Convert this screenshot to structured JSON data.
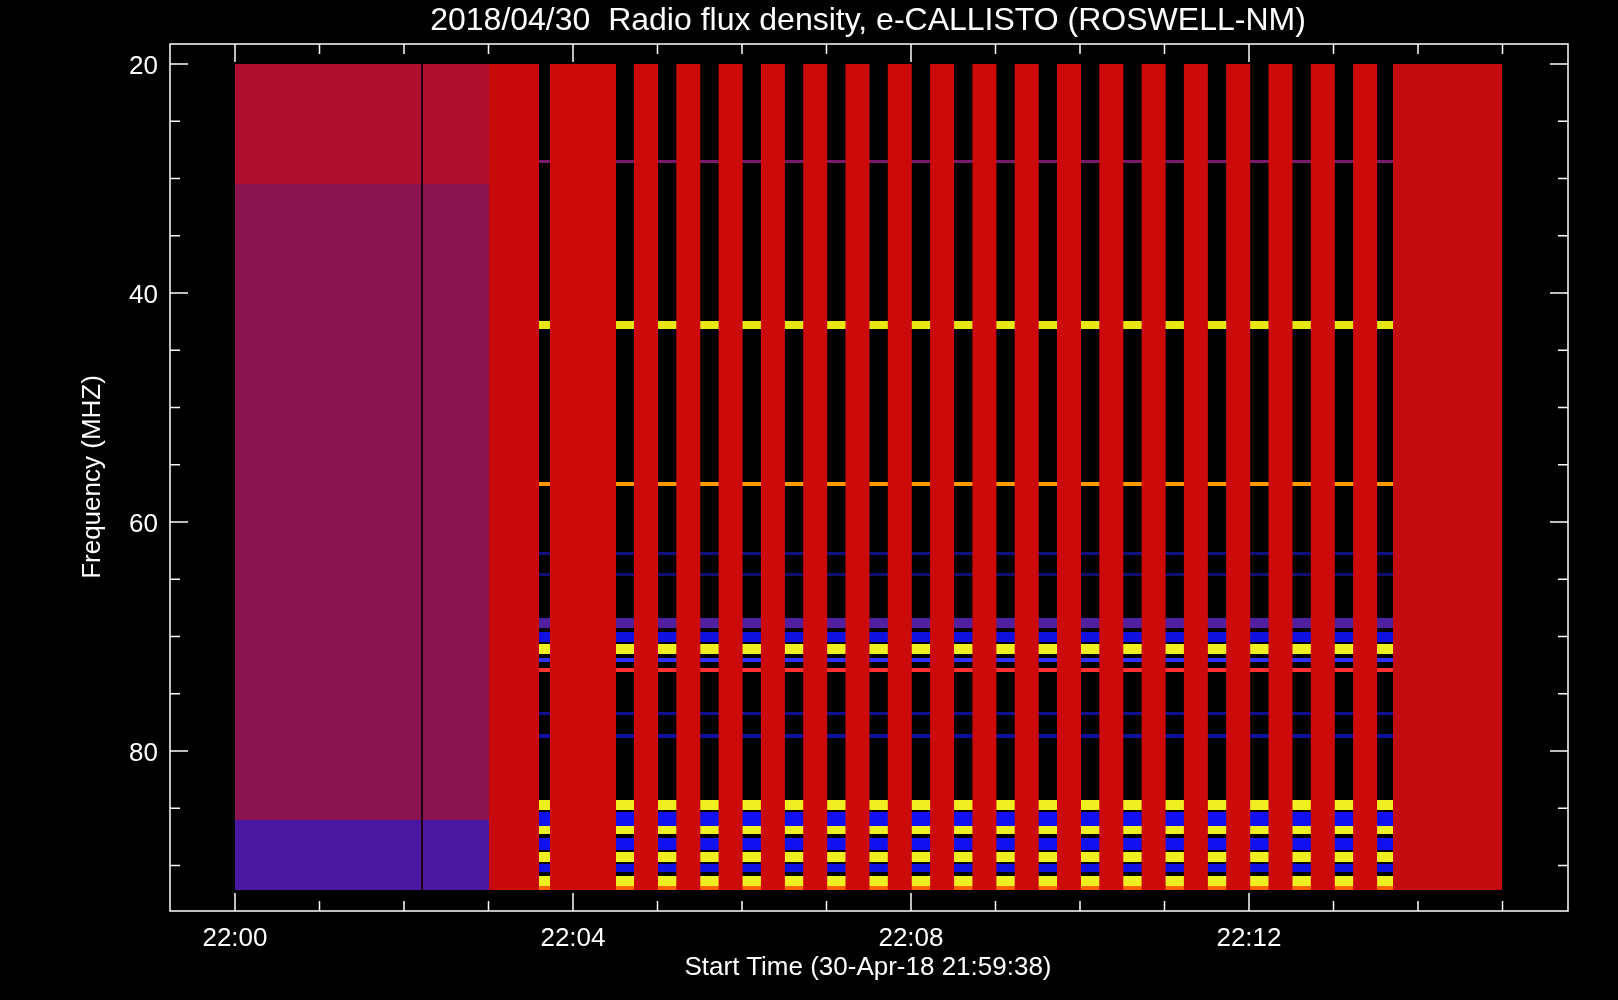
{
  "title": "2018/04/30  Radio flux density, e-CALLISTO (ROSWELL-NM)",
  "plot": {
    "ylabel": "Frequency (MHZ)",
    "xlabel": "Start Time (30-Apr-18 21:59:38)",
    "yticks": [
      "20",
      "40",
      "60",
      "80"
    ],
    "xticks": [
      "22:00",
      "22:04",
      "22:08",
      "22:12"
    ]
  }
}
